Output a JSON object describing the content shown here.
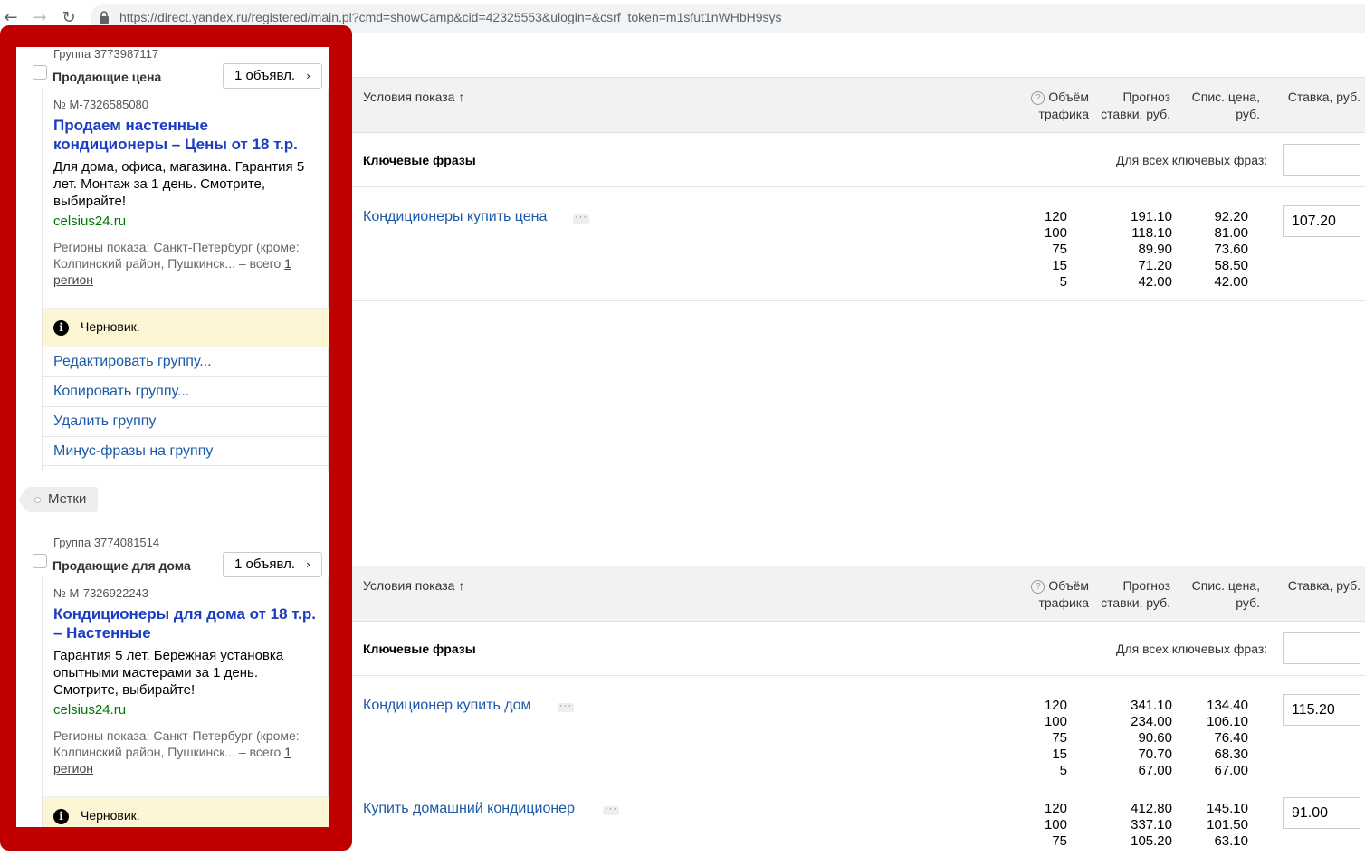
{
  "browser": {
    "back": "←",
    "forward": "→",
    "reload": "↻",
    "url": "https://direct.yandex.ru/registered/main.pl?cmd=showCamp&cid=42325553&ulogin=&csrf_token=m1sfut1nWHbH9sys"
  },
  "groups": [
    {
      "group_id": "Группа 3773987117",
      "name": "Продающие цена",
      "ads_button": "1 объявл.",
      "ad_number": "№ M-7326585080",
      "ad_title": "Продаем настенные кондиционеры – Цены от 18 т.р.",
      "ad_text": "Для дома, офиса, магазина. Гарантия 5 лет. Монтаж за 1 день. Смотрите, выбирайте!",
      "domain": "celsius24.ru",
      "regions_prefix": "Регионы показа: Санкт-Петербург (кроме: Колпинский район, Пушкинск... – всего ",
      "regions_link": "1 регион",
      "status": "Черновик.",
      "actions": [
        "Редактировать группу...",
        "Копировать группу...",
        "Удалить группу",
        "Минус-фразы на группу"
      ],
      "tags": "Метки"
    },
    {
      "group_id": "Группа 3774081514",
      "name": "Продающие для дома",
      "ads_button": "1 объявл.",
      "ad_number": "№ M-7326922243",
      "ad_title": "Кондиционеры для дома от 18 т.р. – Настенные",
      "ad_text": "Гарантия 5 лет. Бережная установка опытными мастерами за 1 день. Смотрите, выбирайте!",
      "domain": "celsius24.ru",
      "regions_prefix": "Регионы показа: Санкт-Петербург (кроме: Колпинский район, Пушкинск... – всего ",
      "regions_link": "1 регион",
      "status": "Черновик."
    }
  ],
  "table_header": {
    "conditions": "Условия показа ↑",
    "volume": "Объём трафика",
    "forecast": "Прогноз ставки, руб.",
    "spis": "Спис. цена, руб.",
    "bid": "Ставка, руб.",
    "keyphrases": "Ключевые фразы",
    "for_all": "Для всех ключевых фраз:"
  },
  "tables": [
    {
      "keywords": [
        {
          "phrase": "Кондиционеры купить цена",
          "volume": "120\n100\n75\n15\n5",
          "forecast": "191.10\n118.10\n89.90\n71.20\n42.00",
          "spis": "92.20\n81.00\n73.60\n58.50\n42.00",
          "bid": "107.20"
        }
      ]
    },
    {
      "keywords": [
        {
          "phrase": "Кондиционер купить дом",
          "volume": "120\n100\n75\n15\n5",
          "forecast": "341.10\n234.00\n90.60\n70.70\n67.00",
          "spis": "134.40\n106.10\n76.40\n68.30\n67.00",
          "bid": "115.20"
        },
        {
          "phrase": "Купить домашний кондиционер",
          "volume": "120\n100\n75",
          "forecast": "412.80\n337.10\n105.20",
          "spis": "145.10\n101.50\n63.10",
          "bid": "91.00"
        }
      ]
    }
  ]
}
